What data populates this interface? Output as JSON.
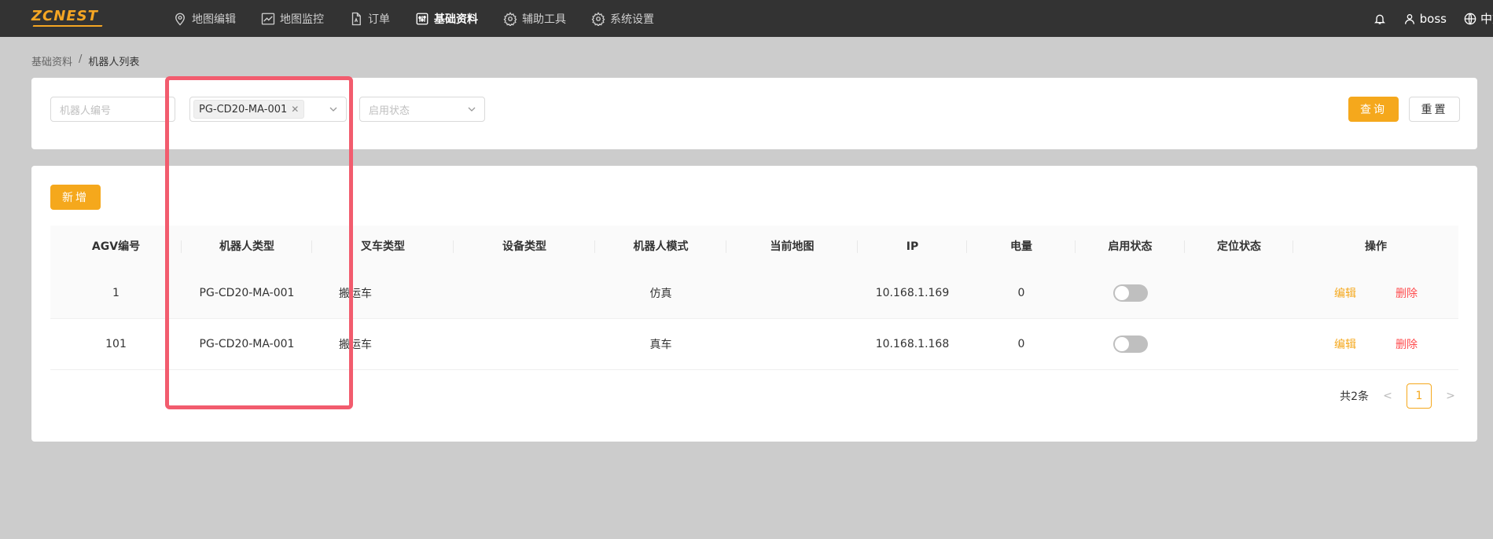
{
  "app": {
    "logo_text": "ZCNEST",
    "brand_color": "#f5a81c"
  },
  "nav": {
    "items": [
      {
        "label": "地图编辑",
        "icon": "map-pin-icon"
      },
      {
        "label": "地图监控",
        "icon": "chart-line-icon"
      },
      {
        "label": "订单",
        "icon": "document-icon"
      },
      {
        "label": "基础资料",
        "icon": "sliders-icon",
        "active": true
      },
      {
        "label": "辅助工具",
        "icon": "gear-icon"
      },
      {
        "label": "系统设置",
        "icon": "gear-icon"
      }
    ],
    "user": "boss",
    "language": "中文"
  },
  "breadcrumb": {
    "parent": "基础资料",
    "separator": "/",
    "current": "机器人列表"
  },
  "search": {
    "robot_id_placeholder": "机器人编号",
    "robot_type_selected": "PG-CD20-MA-001",
    "status_placeholder": "启用状态",
    "query_label": "查询",
    "reset_label": "重置"
  },
  "toolbar": {
    "add_label": "新增"
  },
  "table": {
    "columns": [
      "AGV编号",
      "机器人类型",
      "叉车类型",
      "设备类型",
      "机器人模式",
      "当前地图",
      "IP",
      "电量",
      "启用状态",
      "定位状态",
      "操作"
    ],
    "rows": [
      {
        "agv_id": "1",
        "robot_type": "PG-CD20-MA-001",
        "forklift_type": "搬运车",
        "device_type": "",
        "mode": "仿真",
        "map": "",
        "ip": "10.168.1.169",
        "battery": "0",
        "enabled": false,
        "locate": "",
        "edit": "编辑",
        "delete": "删除"
      },
      {
        "agv_id": "101",
        "robot_type": "PG-CD20-MA-001",
        "forklift_type": "搬运车",
        "device_type": "",
        "mode": "真车",
        "map": "",
        "ip": "10.168.1.168",
        "battery": "0",
        "enabled": false,
        "locate": "",
        "edit": "编辑",
        "delete": "删除"
      }
    ]
  },
  "pagination": {
    "total": "共2条",
    "current_page": "1"
  }
}
